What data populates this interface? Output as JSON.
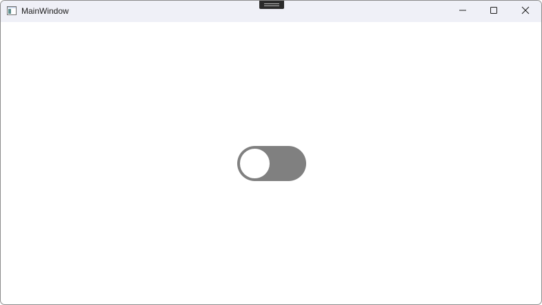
{
  "window": {
    "title": "MainWindow",
    "controls": {
      "minimize": "minimize-icon",
      "maximize": "maximize-icon",
      "close": "close-icon"
    }
  },
  "toggle": {
    "state": "off",
    "track_color": "#808080",
    "thumb_color": "#ffffff"
  }
}
